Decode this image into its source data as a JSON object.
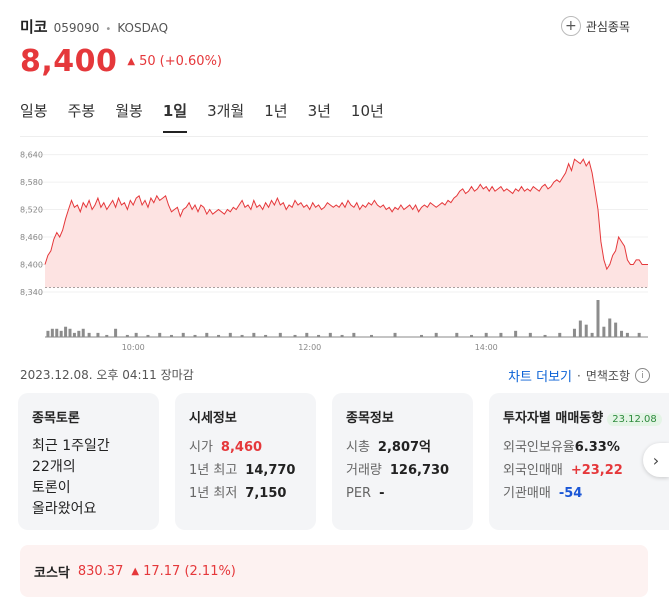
{
  "stock": {
    "name": "미코",
    "code": "059090",
    "market": "KOSDAQ",
    "price": "8,400",
    "change": "50",
    "change_pct": "(+0.60%)",
    "watch_label": "관심종목"
  },
  "tabs": [
    "일봉",
    "주봉",
    "월봉",
    "1일",
    "3개월",
    "1년",
    "3년",
    "10년"
  ],
  "active_tab": "1일",
  "chart_data": {
    "type": "area",
    "ytick_labels": [
      "8,640",
      "8,580",
      "8,520",
      "8,460",
      "8,400",
      "8,340"
    ],
    "yticks": [
      8640,
      8580,
      8520,
      8460,
      8400,
      8340
    ],
    "ylim": [
      8340,
      8650
    ],
    "xtick_labels": [
      "10:00",
      "12:00",
      "14:00"
    ],
    "xticks": [
      60,
      180,
      300
    ],
    "x_range": [
      0,
      410
    ],
    "previous_close": 8350,
    "colors": {
      "line": "#e5383b",
      "fill": "#fde3e2",
      "volume": "#8c8c8c"
    },
    "price_series": [
      [
        0,
        8400
      ],
      [
        2,
        8420
      ],
      [
        4,
        8430
      ],
      [
        6,
        8455
      ],
      [
        8,
        8470
      ],
      [
        10,
        8460
      ],
      [
        12,
        8475
      ],
      [
        14,
        8500
      ],
      [
        16,
        8520
      ],
      [
        18,
        8540
      ],
      [
        20,
        8525
      ],
      [
        22,
        8530
      ],
      [
        24,
        8515
      ],
      [
        26,
        8535
      ],
      [
        28,
        8525
      ],
      [
        30,
        8540
      ],
      [
        32,
        8520
      ],
      [
        34,
        8530
      ],
      [
        36,
        8545
      ],
      [
        38,
        8525
      ],
      [
        40,
        8535
      ],
      [
        42,
        8520
      ],
      [
        44,
        8530
      ],
      [
        46,
        8540
      ],
      [
        48,
        8525
      ],
      [
        50,
        8545
      ],
      [
        52,
        8530
      ],
      [
        54,
        8535
      ],
      [
        56,
        8520
      ],
      [
        58,
        8540
      ],
      [
        60,
        8530
      ],
      [
        62,
        8545
      ],
      [
        64,
        8550
      ],
      [
        66,
        8530
      ],
      [
        68,
        8540
      ],
      [
        70,
        8525
      ],
      [
        72,
        8545
      ],
      [
        74,
        8535
      ],
      [
        76,
        8550
      ],
      [
        78,
        8540
      ],
      [
        80,
        8545
      ],
      [
        82,
        8550
      ],
      [
        84,
        8530
      ],
      [
        86,
        8515
      ],
      [
        88,
        8520
      ],
      [
        90,
        8525
      ],
      [
        92,
        8505
      ],
      [
        94,
        8520
      ],
      [
        96,
        8525
      ],
      [
        98,
        8535
      ],
      [
        100,
        8520
      ],
      [
        102,
        8530
      ],
      [
        104,
        8515
      ],
      [
        106,
        8530
      ],
      [
        108,
        8525
      ],
      [
        110,
        8510
      ],
      [
        112,
        8520
      ],
      [
        114,
        8510
      ],
      [
        116,
        8515
      ],
      [
        118,
        8520
      ],
      [
        120,
        8515
      ],
      [
        122,
        8510
      ],
      [
        124,
        8520
      ],
      [
        126,
        8515
      ],
      [
        128,
        8525
      ],
      [
        130,
        8520
      ],
      [
        132,
        8530
      ],
      [
        134,
        8540
      ],
      [
        136,
        8525
      ],
      [
        138,
        8530
      ],
      [
        140,
        8520
      ],
      [
        142,
        8540
      ],
      [
        144,
        8525
      ],
      [
        146,
        8530
      ],
      [
        148,
        8520
      ],
      [
        150,
        8535
      ],
      [
        152,
        8525
      ],
      [
        154,
        8540
      ],
      [
        156,
        8530
      ],
      [
        158,
        8545
      ],
      [
        160,
        8530
      ],
      [
        162,
        8535
      ],
      [
        164,
        8520
      ],
      [
        166,
        8530
      ],
      [
        168,
        8525
      ],
      [
        170,
        8540
      ],
      [
        172,
        8530
      ],
      [
        174,
        8535
      ],
      [
        176,
        8525
      ],
      [
        178,
        8530
      ],
      [
        180,
        8520
      ],
      [
        182,
        8535
      ],
      [
        184,
        8525
      ],
      [
        186,
        8530
      ],
      [
        188,
        8520
      ],
      [
        190,
        8525
      ],
      [
        192,
        8535
      ],
      [
        194,
        8530
      ],
      [
        196,
        8525
      ],
      [
        198,
        8530
      ],
      [
        200,
        8525
      ],
      [
        202,
        8535
      ],
      [
        204,
        8525
      ],
      [
        206,
        8540
      ],
      [
        208,
        8530
      ],
      [
        210,
        8525
      ],
      [
        212,
        8535
      ],
      [
        214,
        8520
      ],
      [
        216,
        8530
      ],
      [
        218,
        8525
      ],
      [
        220,
        8535
      ],
      [
        222,
        8530
      ],
      [
        224,
        8540
      ],
      [
        226,
        8530
      ],
      [
        228,
        8525
      ],
      [
        230,
        8530
      ],
      [
        232,
        8520
      ],
      [
        234,
        8525
      ],
      [
        236,
        8515
      ],
      [
        238,
        8525
      ],
      [
        240,
        8520
      ],
      [
        242,
        8530
      ],
      [
        244,
        8520
      ],
      [
        246,
        8525
      ],
      [
        248,
        8530
      ],
      [
        250,
        8520
      ],
      [
        252,
        8530
      ],
      [
        254,
        8515
      ],
      [
        256,
        8525
      ],
      [
        258,
        8530
      ],
      [
        260,
        8525
      ],
      [
        262,
        8535
      ],
      [
        264,
        8530
      ],
      [
        266,
        8525
      ],
      [
        268,
        8530
      ],
      [
        270,
        8535
      ],
      [
        272,
        8530
      ],
      [
        274,
        8540
      ],
      [
        276,
        8535
      ],
      [
        278,
        8545
      ],
      [
        280,
        8550
      ],
      [
        282,
        8560
      ],
      [
        284,
        8565
      ],
      [
        286,
        8555
      ],
      [
        288,
        8560
      ],
      [
        290,
        8570
      ],
      [
        292,
        8560
      ],
      [
        294,
        8565
      ],
      [
        296,
        8575
      ],
      [
        298,
        8565
      ],
      [
        300,
        8570
      ],
      [
        302,
        8560
      ],
      [
        304,
        8570
      ],
      [
        306,
        8560
      ],
      [
        308,
        8565
      ],
      [
        310,
        8570
      ],
      [
        312,
        8560
      ],
      [
        314,
        8565
      ],
      [
        316,
        8560
      ],
      [
        318,
        8555
      ],
      [
        320,
        8565
      ],
      [
        322,
        8560
      ],
      [
        324,
        8570
      ],
      [
        326,
        8560
      ],
      [
        328,
        8565
      ],
      [
        330,
        8560
      ],
      [
        332,
        8570
      ],
      [
        334,
        8565
      ],
      [
        336,
        8560
      ],
      [
        338,
        8570
      ],
      [
        340,
        8575
      ],
      [
        342,
        8565
      ],
      [
        344,
        8570
      ],
      [
        346,
        8580
      ],
      [
        348,
        8585
      ],
      [
        350,
        8580
      ],
      [
        352,
        8590
      ],
      [
        354,
        8600
      ],
      [
        356,
        8620
      ],
      [
        358,
        8605
      ],
      [
        360,
        8630
      ],
      [
        362,
        8625
      ],
      [
        364,
        8620
      ],
      [
        366,
        8630
      ],
      [
        368,
        8615
      ],
      [
        370,
        8625
      ],
      [
        372,
        8600
      ],
      [
        374,
        8560
      ],
      [
        376,
        8520
      ],
      [
        378,
        8450
      ],
      [
        380,
        8410
      ],
      [
        382,
        8390
      ],
      [
        384,
        8400
      ],
      [
        386,
        8420
      ],
      [
        388,
        8430
      ],
      [
        390,
        8460
      ],
      [
        392,
        8450
      ],
      [
        394,
        8440
      ],
      [
        396,
        8410
      ],
      [
        398,
        8400
      ],
      [
        400,
        8400
      ],
      [
        402,
        8410
      ],
      [
        404,
        8410
      ],
      [
        406,
        8400
      ],
      [
        408,
        8400
      ],
      [
        410,
        8400
      ]
    ],
    "volume_series": [
      [
        2,
        3
      ],
      [
        5,
        4
      ],
      [
        8,
        4
      ],
      [
        11,
        3
      ],
      [
        14,
        5
      ],
      [
        17,
        4
      ],
      [
        20,
        2
      ],
      [
        23,
        3
      ],
      [
        26,
        4
      ],
      [
        30,
        2
      ],
      [
        36,
        2
      ],
      [
        42,
        1
      ],
      [
        48,
        4
      ],
      [
        56,
        1
      ],
      [
        62,
        2
      ],
      [
        70,
        1
      ],
      [
        78,
        2
      ],
      [
        86,
        1
      ],
      [
        94,
        2
      ],
      [
        102,
        1
      ],
      [
        110,
        2
      ],
      [
        118,
        1
      ],
      [
        126,
        2
      ],
      [
        134,
        1
      ],
      [
        142,
        2
      ],
      [
        150,
        1
      ],
      [
        160,
        2
      ],
      [
        170,
        1
      ],
      [
        178,
        2
      ],
      [
        186,
        1
      ],
      [
        194,
        2
      ],
      [
        202,
        1
      ],
      [
        210,
        2
      ],
      [
        222,
        1
      ],
      [
        238,
        2
      ],
      [
        256,
        1
      ],
      [
        266,
        2
      ],
      [
        280,
        2
      ],
      [
        290,
        1
      ],
      [
        300,
        2
      ],
      [
        310,
        2
      ],
      [
        320,
        3
      ],
      [
        330,
        2
      ],
      [
        340,
        1
      ],
      [
        350,
        2
      ],
      [
        360,
        4
      ],
      [
        364,
        8
      ],
      [
        368,
        6
      ],
      [
        372,
        2
      ],
      [
        376,
        18
      ],
      [
        380,
        5
      ],
      [
        384,
        9
      ],
      [
        388,
        7
      ],
      [
        392,
        3
      ],
      [
        396,
        2
      ],
      [
        404,
        2
      ]
    ]
  },
  "status": {
    "datetime": "2023.12.08. 오후 04:11 장마감",
    "more_chart": "차트 더보기",
    "sep": "·",
    "disclaimer": "면책조항"
  },
  "cards": {
    "discussion": {
      "title": "종목토론",
      "line1": "최근 1주일간",
      "line2": "22개의",
      "line3": "토론이",
      "line4": "올라왔어요"
    },
    "market": {
      "title": "시세정보",
      "rows": [
        {
          "k": "시가",
          "v": "8,460"
        },
        {
          "k": "1년 최고",
          "v": "14,770"
        },
        {
          "k": "1년 최저",
          "v": "7,150"
        }
      ]
    },
    "info": {
      "title": "종목정보",
      "rows": [
        {
          "k": "시총",
          "v": "2,807억"
        },
        {
          "k": "거래량",
          "v": "126,730"
        },
        {
          "k": "PER",
          "v": "-"
        }
      ]
    },
    "investor": {
      "title": "투자자별 매매동향",
      "badge": "23.12.08",
      "rows": [
        {
          "k": "외국인보유율",
          "v": "6.33%"
        },
        {
          "k": "외국인매매",
          "v": "+23,22"
        },
        {
          "k": "기관매매",
          "v": "-54"
        }
      ]
    }
  },
  "index": {
    "name": "코스닥",
    "value": "830.37",
    "change": "17.17 (2.11%)"
  }
}
